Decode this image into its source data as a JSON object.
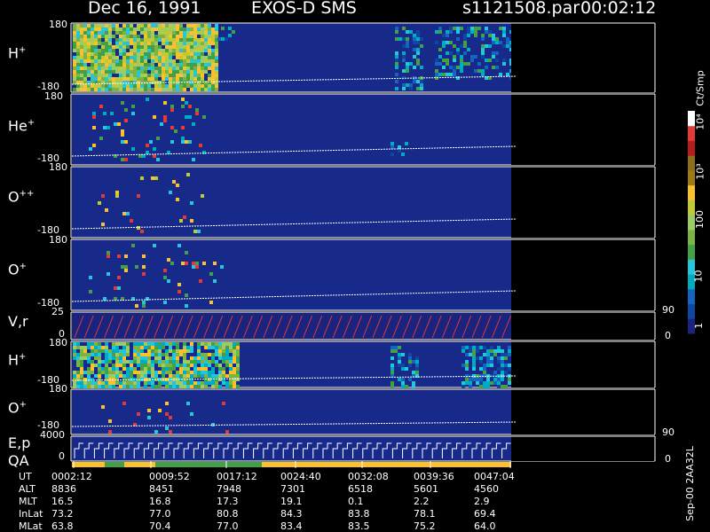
{
  "header": {
    "date": "Dec 16, 1991",
    "mission": "EXOS-D SMS",
    "file": "s1121508.par",
    "time": "00:02:12"
  },
  "footer": {
    "version": "Sep-00 2AA32L"
  },
  "colorbar": {
    "unit": "Ct/Smp",
    "labels": [
      "1",
      "10",
      "100",
      "10³",
      "10⁴"
    ],
    "colors": [
      "#1a237e",
      "#0d47a1",
      "#1565c0",
      "#00acc1",
      "#26c6da",
      "#43a047",
      "#7cb342",
      "#9ccc65",
      "#c0ca33",
      "#fbc02d",
      "#9e7a17",
      "#8d6e1b",
      "#b71c1c",
      "#e53935",
      "#ffffff"
    ]
  },
  "panels": [
    {
      "id": "h1",
      "label": "H",
      "sup": "+",
      "top_tick": "180",
      "bottom_tick": "-180",
      "right_tick": ""
    },
    {
      "id": "he",
      "label": "He",
      "sup": "+",
      "top_tick": "180",
      "bottom_tick": "-180",
      "right_tick": ""
    },
    {
      "id": "opp",
      "label": "O",
      "sup": "++",
      "top_tick": "180",
      "bottom_tick": "-180",
      "right_tick": ""
    },
    {
      "id": "op1",
      "label": "O",
      "sup": "+",
      "top_tick": "180",
      "bottom_tick": "-180",
      "right_tick": "90"
    },
    {
      "id": "vr",
      "label": "V,r",
      "sup": "",
      "top_tick": "25",
      "bottom_tick": "0",
      "right_tick": "0"
    },
    {
      "id": "h2",
      "label": "H",
      "sup": "+",
      "top_tick": "180",
      "bottom_tick": "-180",
      "right_tick": ""
    },
    {
      "id": "op2",
      "label": "O",
      "sup": "+",
      "top_tick": "180",
      "bottom_tick": "-180",
      "right_tick": "90"
    },
    {
      "id": "ep",
      "label": "E,p",
      "sup": "",
      "top_tick": "4000",
      "bottom_tick": "0",
      "right_tick": "0"
    }
  ],
  "qa_label": "QA",
  "ephemeris": {
    "row_labels": [
      "UT",
      "ALT",
      "MLT",
      "InLat",
      "MLat"
    ],
    "columns": [
      [
        "0002:12",
        "8836",
        "16.5",
        "73.2",
        "63.8"
      ],
      [
        "0009:52",
        "8451",
        "16.8",
        "77.0",
        "70.4"
      ],
      [
        "0017:12",
        "7948",
        "17.3",
        "80.8",
        "77.0"
      ],
      [
        "0024:40",
        "7301",
        "19.1",
        "84.3",
        "83.4"
      ],
      [
        "0032:08",
        "6518",
        "0.1",
        "83.8",
        "83.5"
      ],
      [
        "0039:36",
        "5601",
        "2.2",
        "78.1",
        "75.2"
      ],
      [
        "0047:04",
        "4560",
        "2.9",
        "69.4",
        "64.0"
      ]
    ]
  },
  "chart_data": {
    "type": "heatmap",
    "title": "Dec 16, 1991 EXOS-D SMS",
    "x_ticks": [
      "0002:12",
      "0009:52",
      "0017:12",
      "0024:40",
      "0032:08",
      "0039:36",
      "0047:04"
    ],
    "colorbar_unit": "Ct/Smp",
    "colorbar_scale": "log",
    "colorbar_range": [
      1,
      10000
    ],
    "panels": [
      "H+",
      "He+",
      "O++",
      "O+",
      "V,r",
      "H+",
      "O+",
      "E,p"
    ],
    "pitch_angle_range": [
      -180,
      180
    ]
  }
}
